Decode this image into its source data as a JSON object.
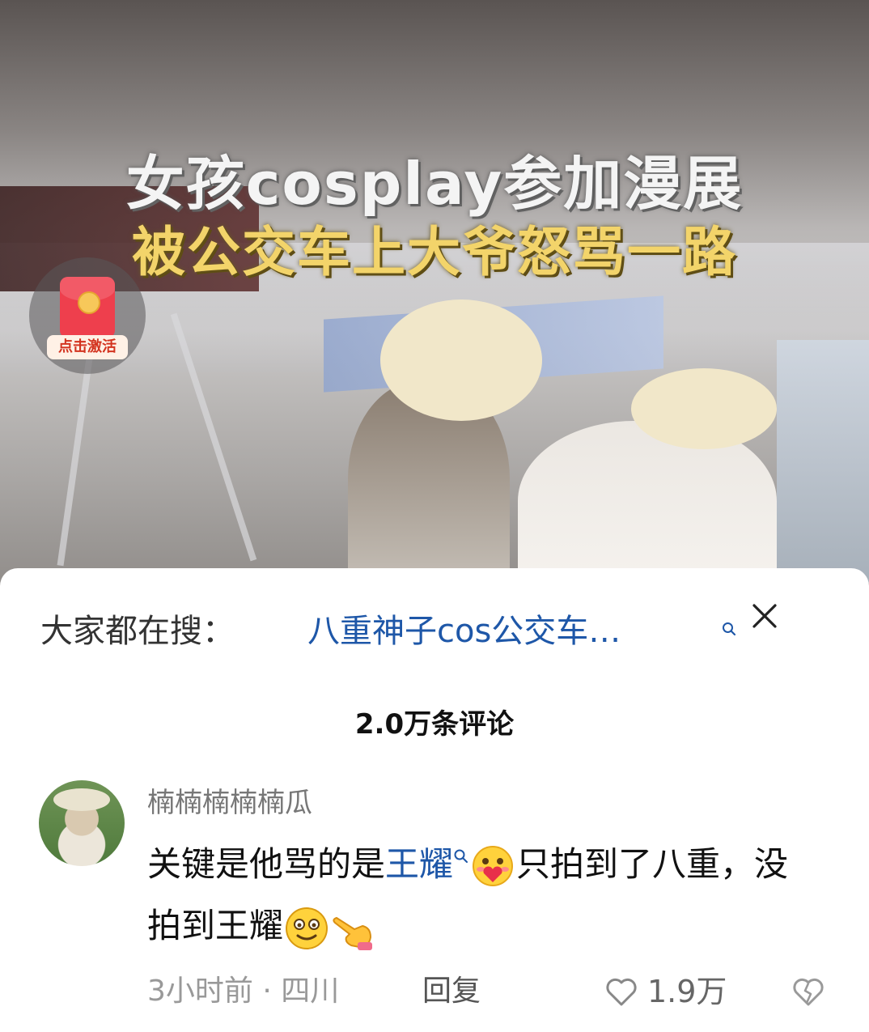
{
  "video": {
    "title_line1": "女孩cosplay参加漫展",
    "title_line2": "被公交车上大爷怒骂一路",
    "redpacket_label": "点击激活"
  },
  "search_bar": {
    "prefix": "大家都在搜：",
    "query": "八重神子cos公交车…"
  },
  "comments_count": "2.0万条评论",
  "comment": {
    "username": "楠楠楠楠楠瓜",
    "text_part1": "关键是他骂的是",
    "keyword": "王耀",
    "text_part2": "只拍到了八重，没拍到王耀",
    "time": "3小时前",
    "separator": "·",
    "location": "四川",
    "reply_label": "回复",
    "like_count": "1.9万"
  },
  "colors": {
    "link_blue": "#1e57a8",
    "redpacket_red": "#ee3f4d",
    "title_yellow": "#f3d46a"
  }
}
